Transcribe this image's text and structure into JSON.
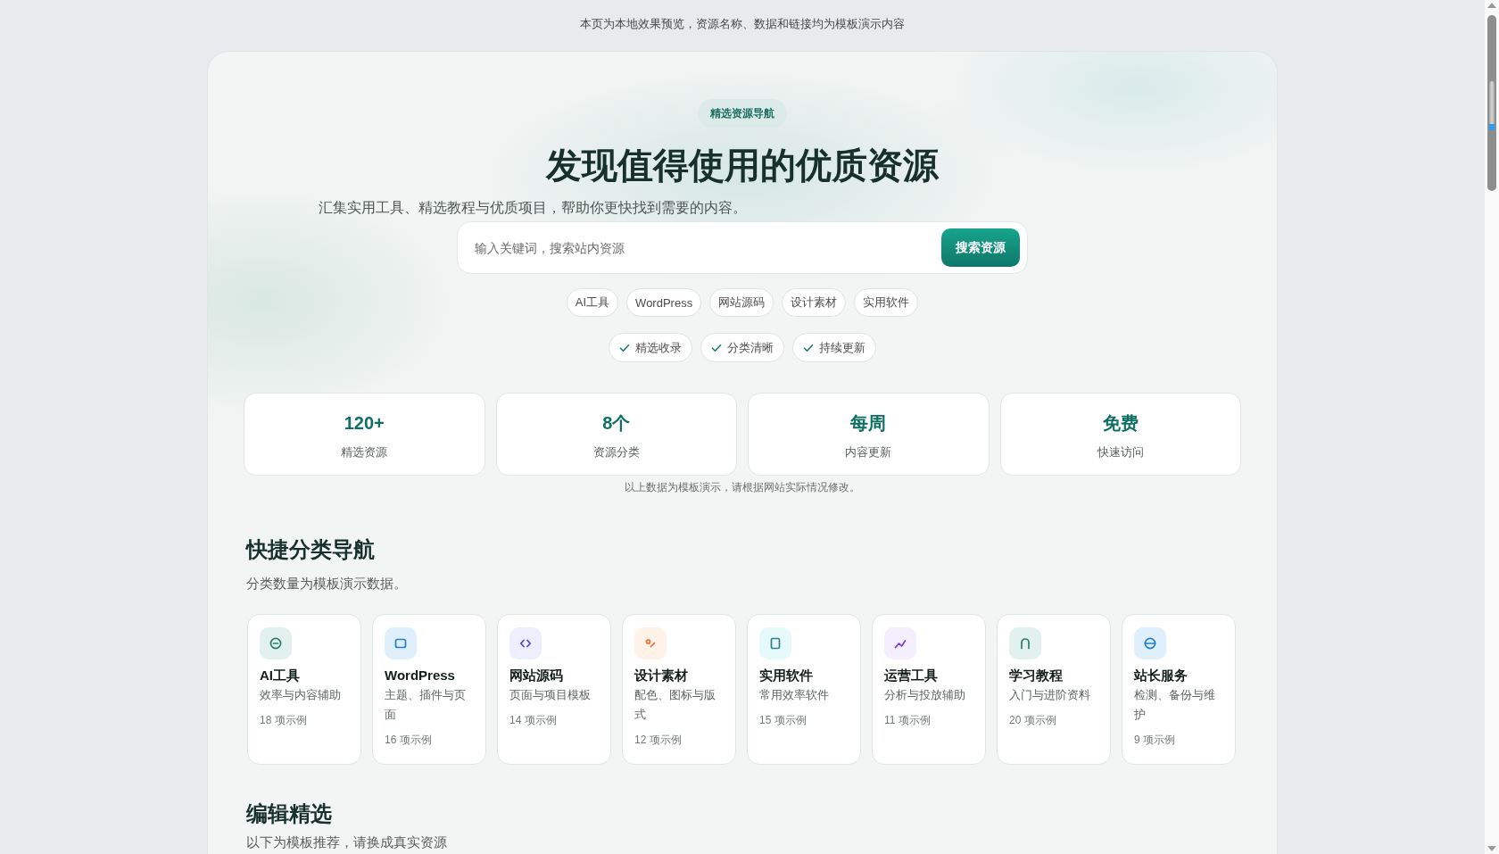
{
  "notice": "本页为本地效果预览，资源名称、数据和链接均为模板演示内容",
  "hero": {
    "badge": "精选资源导航",
    "title": "发现值得使用的优质资源",
    "subtitle": "汇集实用工具、精选教程与优质项目，帮助你更快找到需要的内容。",
    "search": {
      "placeholder": "输入关键词，搜索站内资源",
      "button": "搜索资源"
    },
    "tags": [
      "AI工具",
      "WordPress",
      "网站源码",
      "设计素材",
      "实用软件"
    ],
    "features": [
      "精选收录",
      "分类清晰",
      "持续更新"
    ]
  },
  "stats": {
    "items": [
      {
        "value": "120+",
        "label": "精选资源"
      },
      {
        "value": "8个",
        "label": "资源分类"
      },
      {
        "value": "每周",
        "label": "内容更新"
      },
      {
        "value": "免费",
        "label": "快速访问"
      }
    ],
    "note": "以上数据为模板演示，请根据网站实际情况修改。"
  },
  "categories": {
    "title": "快捷分类导航",
    "subtitle": "分类数量为模板演示数据。",
    "items": [
      {
        "name": "AI工具",
        "description": "效率与内容辅助",
        "count": "18 项示例"
      },
      {
        "name": "WordPress",
        "description": "主题、插件与页面",
        "count": "16 项示例"
      },
      {
        "name": "网站源码",
        "description": "页面与项目模板",
        "count": "14 项示例"
      },
      {
        "name": "设计素材",
        "description": "配色、图标与版式",
        "count": "12 项示例"
      },
      {
        "name": "实用软件",
        "description": "常用效率软件",
        "count": "15 项示例"
      },
      {
        "name": "运营工具",
        "description": "分析与投放辅助",
        "count": "11 项示例"
      },
      {
        "name": "学习教程",
        "description": "入门与进阶资料",
        "count": "20 项示例"
      },
      {
        "name": "站长服务",
        "description": "检测、备份与维护",
        "count": "9 项示例"
      }
    ]
  },
  "editor_picks": {
    "title": "编辑精选",
    "subtitle": "以下为模板推荐，请换成真实资源"
  }
}
